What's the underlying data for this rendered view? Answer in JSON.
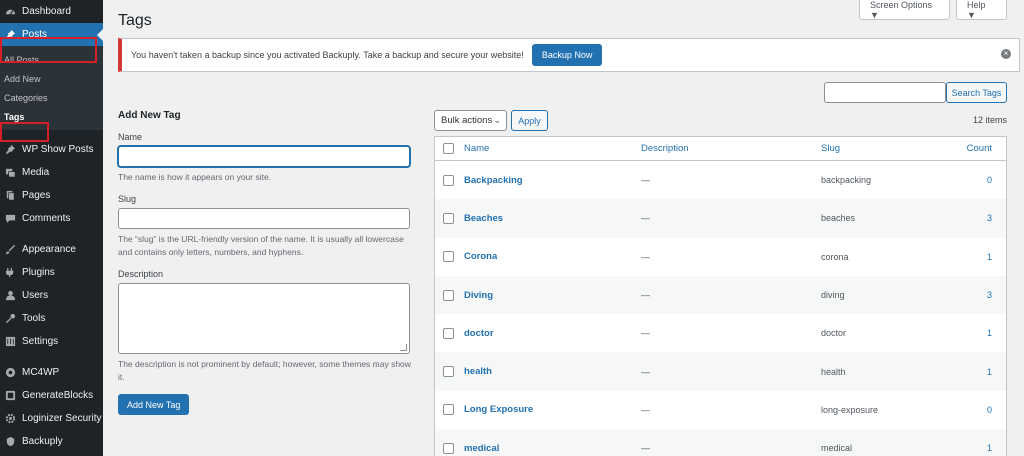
{
  "sidebar": {
    "items_top": [
      {
        "label": "Dashboard",
        "icon": "dashboard-icon"
      },
      {
        "label": "Posts",
        "icon": "pin-icon",
        "active": true
      }
    ],
    "posts_submenu": [
      "All Posts",
      "Add New",
      "Categories",
      "Tags"
    ],
    "items_bottom": [
      {
        "label": "WP Show Posts",
        "icon": "pin-icon"
      },
      {
        "label": "Media",
        "icon": "media-icon"
      },
      {
        "label": "Pages",
        "icon": "pages-icon"
      },
      {
        "label": "Comments",
        "icon": "comments-icon"
      },
      {
        "label": "Appearance",
        "icon": "appearance-icon"
      },
      {
        "label": "Plugins",
        "icon": "plugins-icon"
      },
      {
        "label": "Users",
        "icon": "users-icon"
      },
      {
        "label": "Tools",
        "icon": "tools-icon"
      },
      {
        "label": "Settings",
        "icon": "settings-icon"
      },
      {
        "label": "MC4WP",
        "icon": "mc4wp-icon"
      },
      {
        "label": "GenerateBlocks",
        "icon": "generateblocks-icon"
      },
      {
        "label": "Loginizer Security",
        "icon": "gear-icon"
      },
      {
        "label": "Backuply",
        "icon": "backuply-icon"
      }
    ]
  },
  "header": {
    "title": "Tags",
    "screen_options": "Screen Options ▼",
    "help": "Help ▼"
  },
  "notice": {
    "text": "You haven't taken a backup since you activated Backuply. Take a backup and secure your website!",
    "button": "Backup Now"
  },
  "form": {
    "heading": "Add New Tag",
    "name_label": "Name",
    "name_help": "The name is how it appears on your site.",
    "slug_label": "Slug",
    "slug_help": "The “slug” is the URL-friendly version of the name. It is usually all lowercase and contains only letters, numbers, and hyphens.",
    "description_label": "Description",
    "description_help": "The description is not prominent by default; however, some themes may show it.",
    "submit": "Add New Tag"
  },
  "list": {
    "search_button": "Search Tags",
    "bulk_actions": "Bulk actions",
    "apply": "Apply",
    "items_count": "12 items",
    "columns": {
      "name": "Name",
      "description": "Description",
      "slug": "Slug",
      "count": "Count"
    },
    "rows": [
      {
        "name": "Backpacking",
        "description": "—",
        "slug": "backpacking",
        "count": "0"
      },
      {
        "name": "Beaches",
        "description": "—",
        "slug": "beaches",
        "count": "3"
      },
      {
        "name": "Corona",
        "description": "—",
        "slug": "corona",
        "count": "1"
      },
      {
        "name": "Diving",
        "description": "—",
        "slug": "diving",
        "count": "3"
      },
      {
        "name": "doctor",
        "description": "—",
        "slug": "doctor",
        "count": "1"
      },
      {
        "name": "health",
        "description": "—",
        "slug": "health",
        "count": "1"
      },
      {
        "name": "Long Exposure",
        "description": "—",
        "slug": "long-exposure",
        "count": "0"
      },
      {
        "name": "medical",
        "description": "—",
        "slug": "medical",
        "count": "1"
      }
    ]
  },
  "colors": {
    "sidebar_bg": "#1d2327",
    "accent": "#2271b1",
    "highlight_box": "#d61f26",
    "notice_border": "#d63638"
  }
}
